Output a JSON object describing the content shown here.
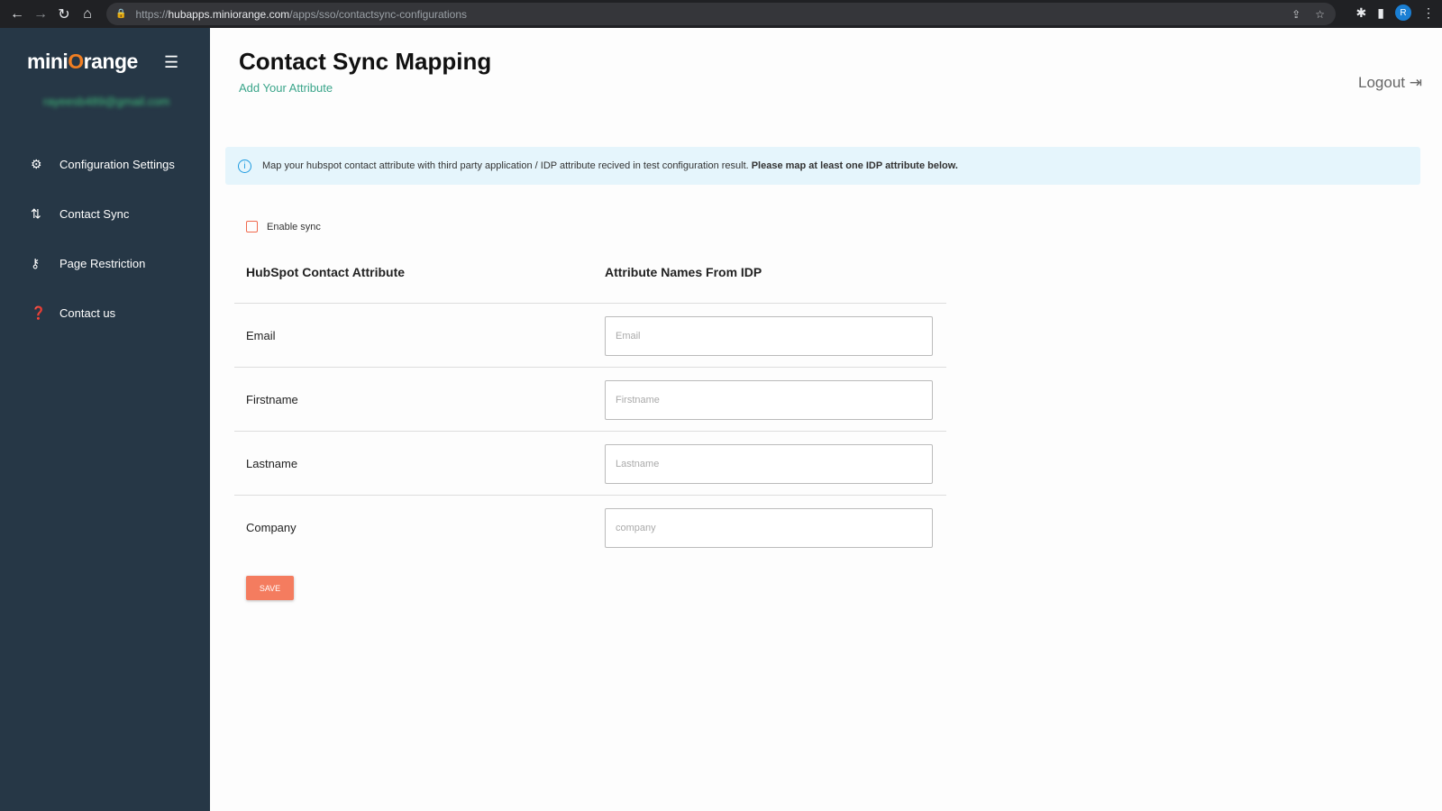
{
  "browser": {
    "url_prefix": "https://",
    "url_host": "hubapps.miniorange.com",
    "url_path": "/apps/sso/contactsync-configurations",
    "profile_initial": "R"
  },
  "sidebar": {
    "logo_pre": "mini",
    "logo_o": "O",
    "logo_post": "range",
    "email": "rayeesb489@gmail.com",
    "items": [
      {
        "label": "Configuration Settings",
        "icon": "gear-icon"
      },
      {
        "label": "Contact Sync",
        "icon": "sync-icon"
      },
      {
        "label": "Page Restriction",
        "icon": "key-icon"
      },
      {
        "label": "Contact us",
        "icon": "help-icon"
      }
    ]
  },
  "header": {
    "title": "Contact Sync Mapping",
    "subtitle": "Add Your Attribute",
    "logout": "Logout"
  },
  "banner": {
    "text": "Map your hubspot contact attribute with third party application / IDP attribute recived in test configuration result. ",
    "bold": "Please map at least one IDP attribute below."
  },
  "enable_sync": {
    "label": "Enable sync",
    "checked": false
  },
  "table": {
    "headers": [
      "HubSpot Contact Attribute",
      "Attribute Names From IDP"
    ],
    "rows": [
      {
        "label": "Email",
        "value": "",
        "placeholder": "Email"
      },
      {
        "label": "Firstname",
        "value": "",
        "placeholder": "Firstname"
      },
      {
        "label": "Lastname",
        "value": "",
        "placeholder": "Lastname"
      },
      {
        "label": "Company",
        "value": "",
        "placeholder": "company"
      }
    ]
  },
  "save_label": "SAVE",
  "colors": {
    "sidebar": "#263746",
    "accent": "#f47c5f",
    "link": "#3aa58a",
    "banner": "#e5f5fc"
  }
}
